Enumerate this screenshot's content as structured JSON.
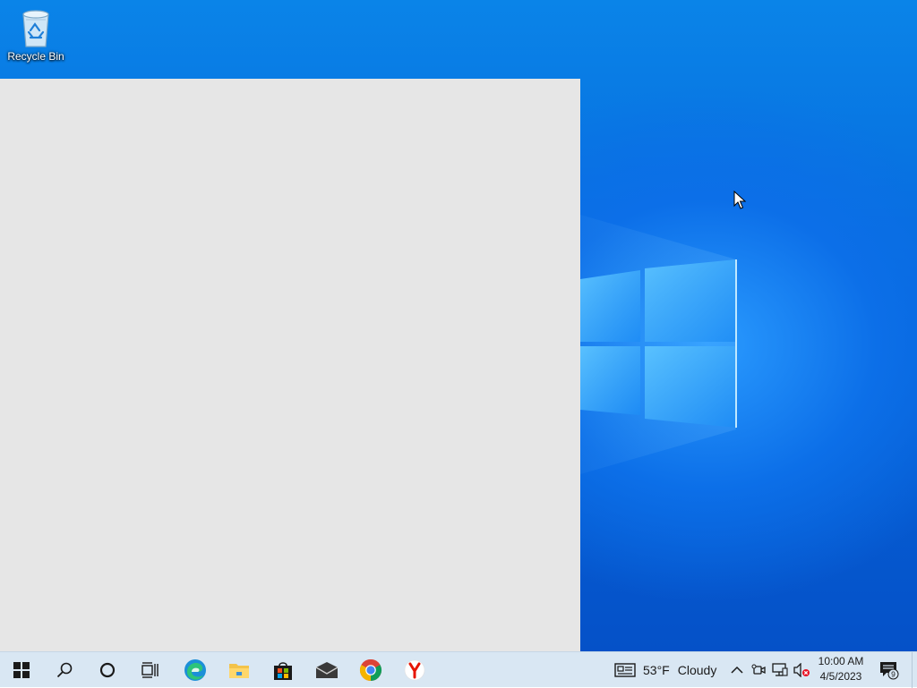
{
  "desktop": {
    "icons": [
      {
        "label": "Recycle Bin",
        "icon": "recycle-bin-icon"
      }
    ]
  },
  "taskbar": {
    "buttons": [
      {
        "name": "start",
        "icon": "windows-start-icon"
      },
      {
        "name": "search",
        "icon": "search-icon"
      },
      {
        "name": "cortana",
        "icon": "cortana-circle-icon"
      },
      {
        "name": "task-view",
        "icon": "task-view-icon"
      },
      {
        "name": "edge",
        "icon": "edge-icon"
      },
      {
        "name": "file-explorer",
        "icon": "folder-icon"
      },
      {
        "name": "store",
        "icon": "store-bag-icon"
      },
      {
        "name": "mail",
        "icon": "mail-icon"
      },
      {
        "name": "chrome",
        "icon": "chrome-icon"
      },
      {
        "name": "yandex",
        "icon": "yandex-icon"
      }
    ],
    "weather": {
      "temperature": "53°F",
      "condition": "Cloudy"
    },
    "tray": {
      "icons": [
        "chevron-up-icon",
        "meet-now-icon",
        "network-icon",
        "volume-muted-icon"
      ]
    },
    "clock": {
      "time": "10:00 AM",
      "date": "4/5/2023"
    },
    "notifications": {
      "count": "9"
    }
  },
  "colors": {
    "desktop_accent": "#0667dc",
    "taskbar_bg": "#d9e7f3",
    "window_bg": "#e6e6e6"
  }
}
